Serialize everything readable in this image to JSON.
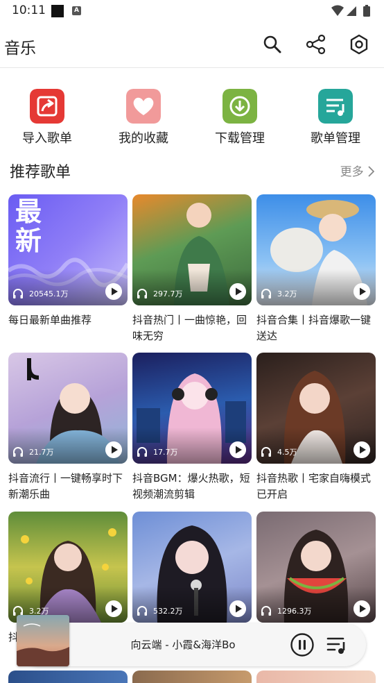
{
  "status_bar": {
    "time": "10:11",
    "notif_badge": "A"
  },
  "app_bar": {
    "title": "音乐"
  },
  "shortcuts": [
    {
      "label": "导入歌单",
      "icon": "import-icon",
      "color": "#e53935"
    },
    {
      "label": "我的收藏",
      "icon": "heart-icon",
      "color": "#f19a9a"
    },
    {
      "label": "下载管理",
      "icon": "download-icon",
      "color": "#7cb342"
    },
    {
      "label": "歌单管理",
      "icon": "playlist-icon",
      "color": "#26a69a"
    }
  ],
  "section": {
    "title": "推荐歌单",
    "more": "更多"
  },
  "playlists": [
    {
      "count": "20545.1万",
      "title": "每日最新单曲推荐",
      "cover_text": [
        "最",
        "新"
      ]
    },
    {
      "count": "297.7万",
      "title": "抖音热门丨一曲惊艳，回味无穷"
    },
    {
      "count": "3.2万",
      "title": "抖音合集丨抖音爆歌一键送达"
    },
    {
      "count": "21.7万",
      "title": "抖音流行丨一键畅享时下新潮乐曲"
    },
    {
      "count": "17.7万",
      "title": "抖音BGM：爆火热歌，短视频潮流剪辑"
    },
    {
      "count": "4.5万",
      "title": "抖音热歌丨宅家自嗨模式已开启"
    },
    {
      "count": "3.2万",
      "title": "抖"
    },
    {
      "count": "532.2万",
      "title": ""
    },
    {
      "count": "1296.3万",
      "title": ""
    }
  ],
  "player": {
    "now_playing": "向云端 - 小霞&海洋Bo"
  },
  "colors": {
    "accent": "#e53935",
    "bg": "#ffffff",
    "muted": "#888888"
  }
}
